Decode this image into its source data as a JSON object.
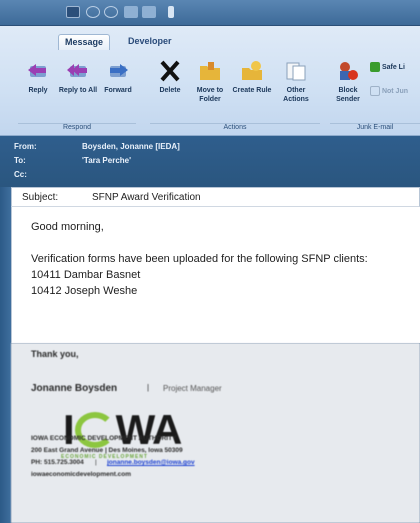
{
  "ribbon": {
    "tabs": [
      "Message",
      "Developer"
    ],
    "buttons": [
      {
        "label": "Reply",
        "icon": "reply-icon"
      },
      {
        "label": "Reply to All",
        "icon": "reply-all-icon"
      },
      {
        "label": "Forward",
        "icon": "forward-icon"
      },
      {
        "label": "Delete",
        "icon": "delete-icon"
      },
      {
        "label": "Move to Folder",
        "icon": "move-to-folder-icon"
      },
      {
        "label": "Create Rule",
        "icon": "create-rule-icon"
      },
      {
        "label": "Other Actions",
        "icon": "other-actions-icon"
      },
      {
        "label": "Block Sender",
        "icon": "block-sender-icon"
      },
      {
        "label": "Safe Li",
        "icon": "safe-list-icon"
      },
      {
        "label": "Not Jun",
        "icon": "not-junk-icon"
      }
    ],
    "groups": [
      "Respond",
      "Actions",
      "Junk E-mail"
    ]
  },
  "header": {
    "from_label": "From:",
    "from_value": "Boysden, Jonanne [IEDA]",
    "to_label": "To:",
    "to_value": "'Tara Perche'",
    "cc_label": "Cc:",
    "subject_label": "Subject:",
    "subject_value": "SFNP Award Verification"
  },
  "body": {
    "greeting": "Good morning,",
    "line1": "Verification forms have been uploaded for the following SFNP clients:",
    "line2": "10411 Dambar Basnet",
    "line3": "10412 Joseph Weshe"
  },
  "signature": {
    "closing": "Thank you,",
    "name": "Jonanne Boysden",
    "separator": "|",
    "title": "Project Manager",
    "logo_text": "IOWA",
    "logo_sub": "ECONOMIC DEVELOPMENT",
    "org": "IOWA ECONOMIC DEVELOPMENT AUTHORITY",
    "address": "200 East Grand Avenue | Des Moines, Iowa 50309",
    "phone": "PH: 515.725.3004",
    "email": "jonanne.boysden@iowa.gov",
    "website": "iowaeconomicdevelopment.com"
  },
  "colors": {
    "accent": "#2f5e8d",
    "logo_green": "#8cc63f",
    "link_blue": "#1a3fd1"
  }
}
